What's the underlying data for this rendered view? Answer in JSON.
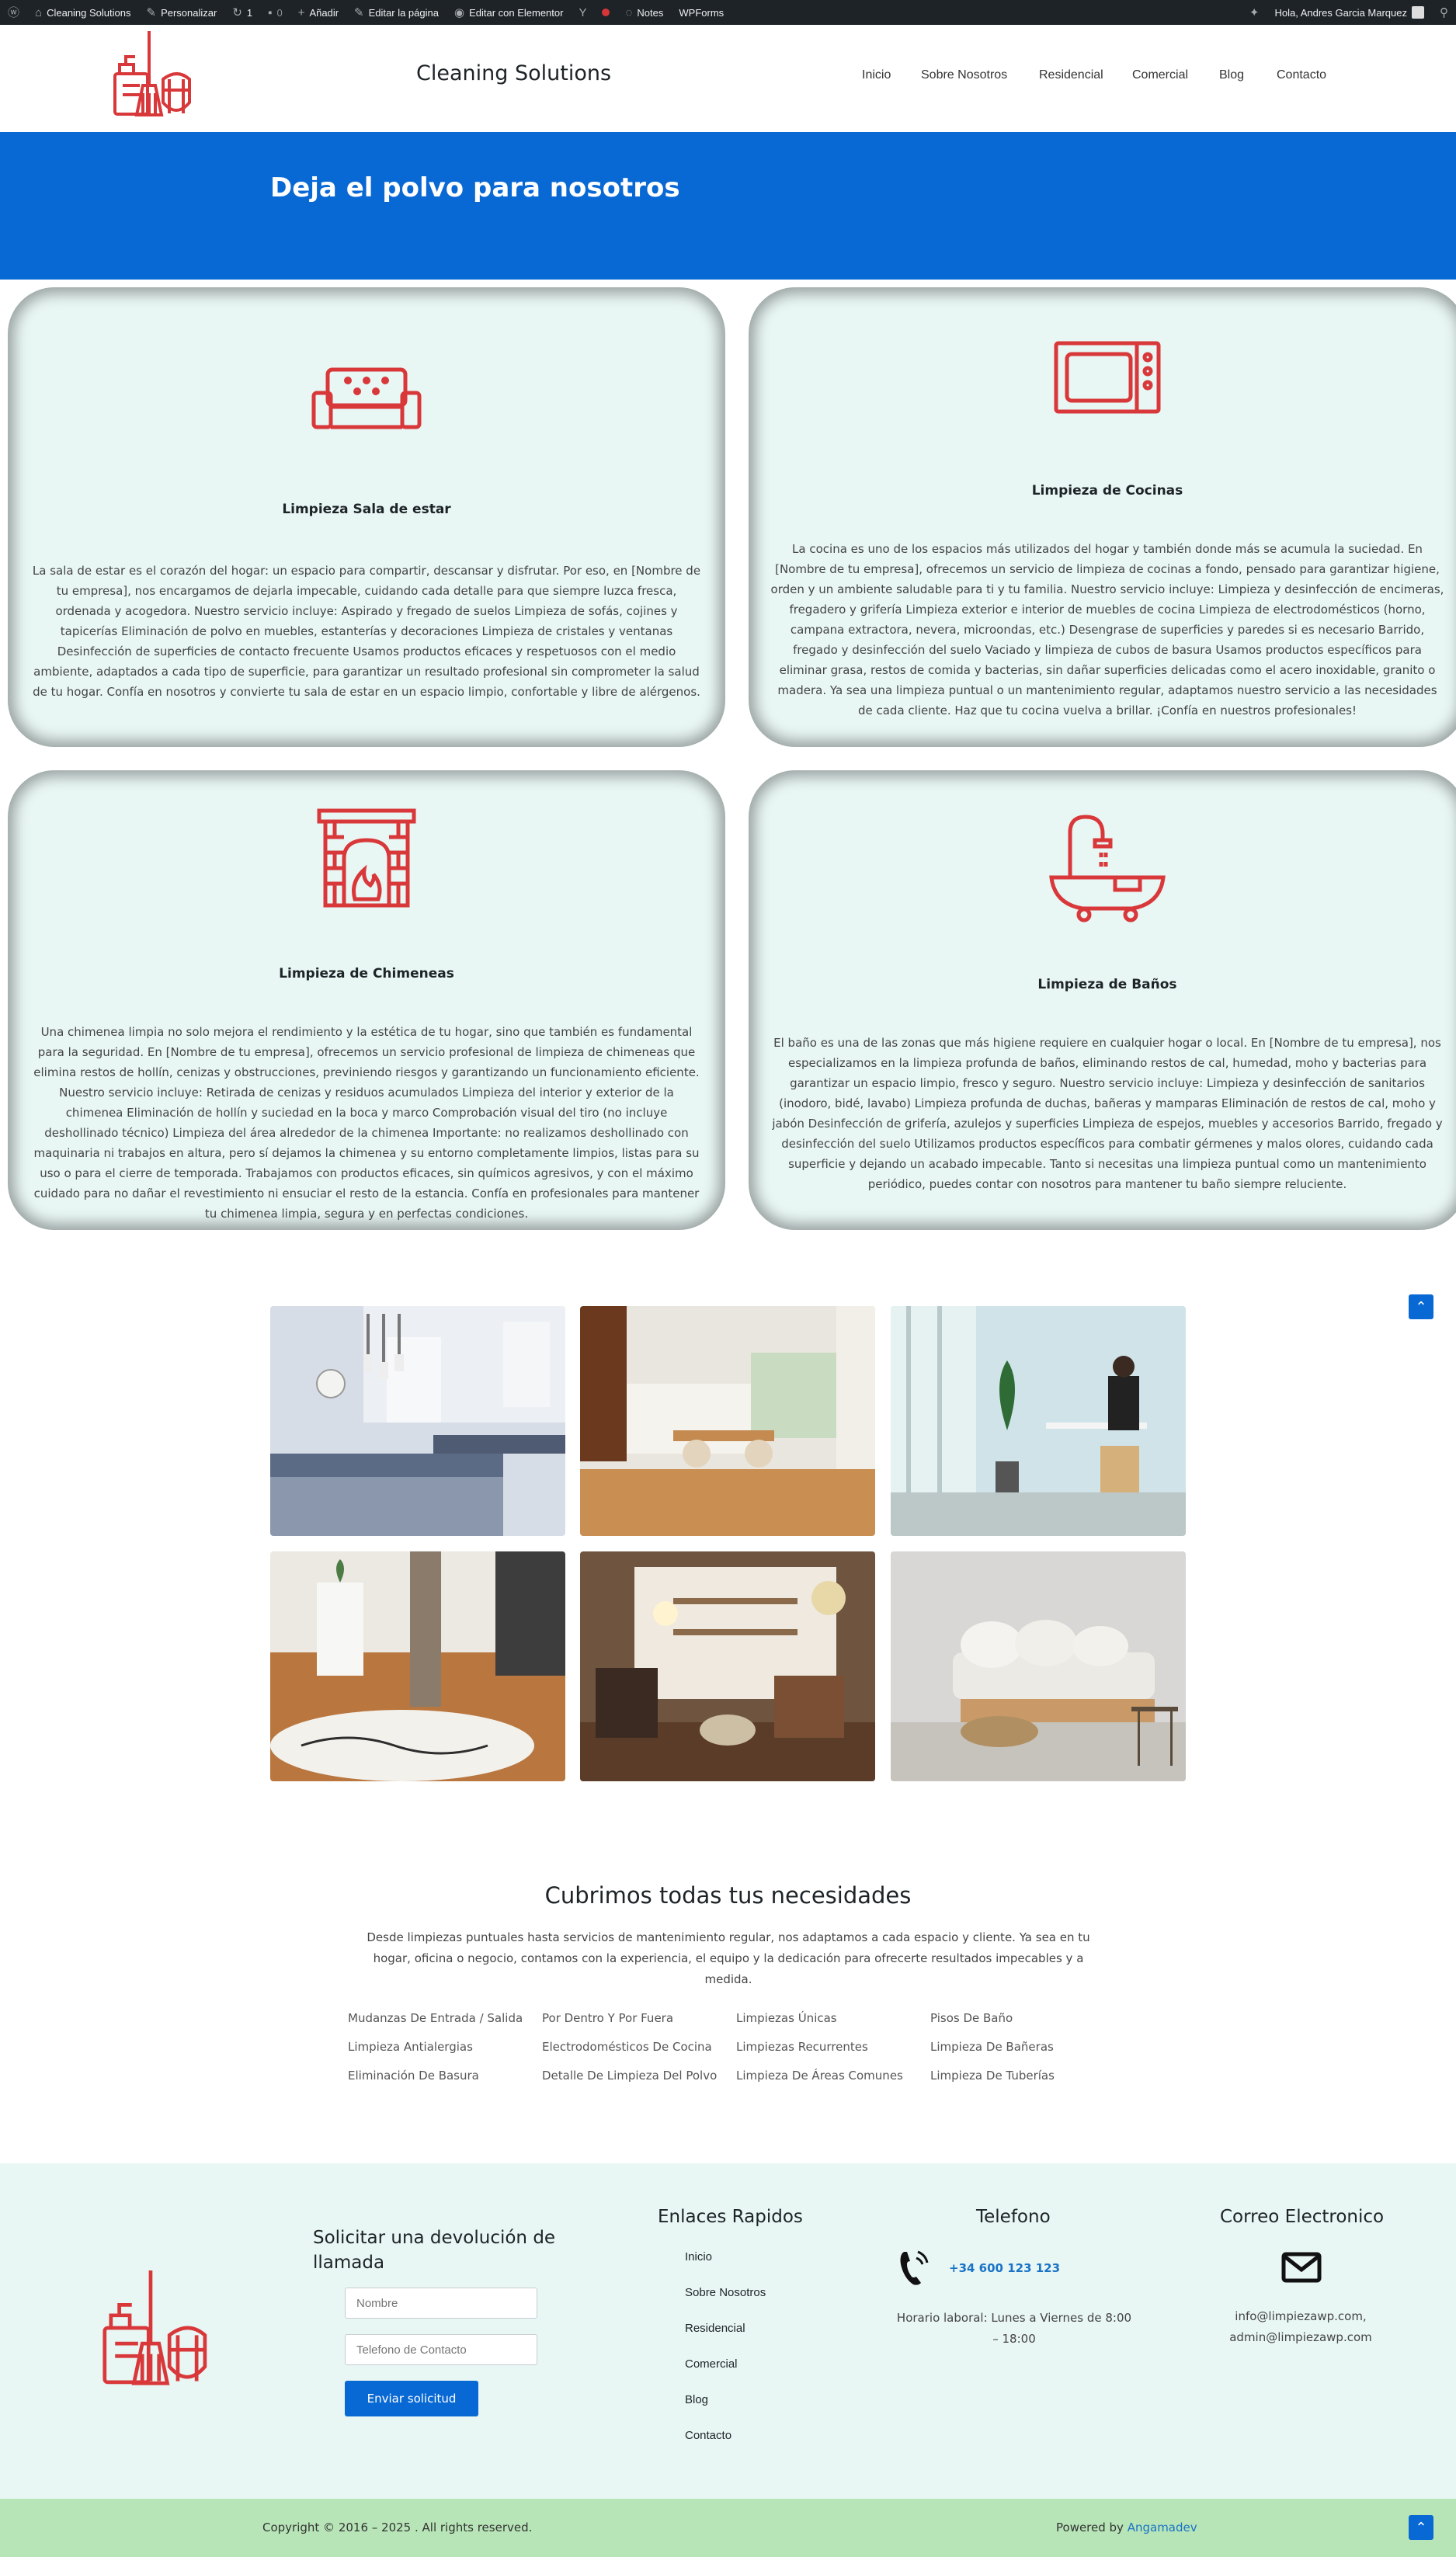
{
  "admin_bar": {
    "site_name": "Cleaning Solutions",
    "customize": "Personalizar",
    "updates": "1",
    "comments": "0",
    "add_new": "Añadir",
    "edit_page": "Editar la página",
    "edit_elementor": "Editar con Elementor",
    "notes": "Notes",
    "wpforms": "WPForms",
    "greeting": "Hola, Andres Garcia Marquez"
  },
  "header": {
    "site_title": "Cleaning Solutions",
    "nav": [
      "Inicio",
      "Sobre Nosotros",
      "Residencial",
      "Comercial",
      "Blog",
      "Contacto"
    ]
  },
  "hero": {
    "title": "Deja el polvo para nosotros"
  },
  "cards": [
    {
      "icon": "sofa-icon",
      "title": "Limpieza Sala de estar",
      "text": "La sala de estar es el corazón del hogar: un espacio para compartir, descansar y disfrutar. Por eso, en [Nombre de tu empresa], nos encargamos de dejarla impecable, cuidando cada detalle para que siempre luzca fresca, ordenada y acogedora. Nuestro servicio incluye: Aspirado y fregado de suelos Limpieza de sofás, cojines y tapicerías Eliminación de polvo en muebles, estanterías y decoraciones Limpieza de cristales y ventanas Desinfección de superficies de contacto frecuente Usamos productos eficaces y respetuosos con el medio ambiente, adaptados a cada tipo de superficie, para garantizar un resultado profesional sin comprometer la salud de tu hogar. Confía en nosotros y convierte tu sala de estar en un espacio limpio, confortable y libre de alérgenos."
    },
    {
      "icon": "microwave-icon",
      "title": "Limpieza de Cocinas",
      "text": "La cocina es uno de los espacios más utilizados del hogar y también donde más se acumula la suciedad. En [Nombre de tu empresa], ofrecemos un servicio de limpieza de cocinas a fondo, pensado para garantizar higiene, orden y un ambiente saludable para ti y tu familia. Nuestro servicio incluye: Limpieza y desinfección de encimeras, fregadero y grifería Limpieza exterior e interior de muebles de cocina Limpieza de electrodomésticos (horno, campana extractora, nevera, microondas, etc.) Desengrase de superficies y paredes si es necesario Barrido, fregado y desinfección del suelo Vaciado y limpieza de cubos de basura Usamos productos específicos para eliminar grasa, restos de comida y bacterias, sin dañar superficies delicadas como el acero inoxidable, granito o madera. Ya sea una limpieza puntual o un mantenimiento regular, adaptamos nuestro servicio a las necesidades de cada cliente. Haz que tu cocina vuelva a brillar. ¡Confía en nuestros profesionales!"
    },
    {
      "icon": "fireplace-icon",
      "title": "Limpieza de Chimeneas",
      "text": "Una chimenea limpia no solo mejora el rendimiento y la estética de tu hogar, sino que también es fundamental para la seguridad. En [Nombre de tu empresa], ofrecemos un servicio profesional de limpieza de chimeneas que elimina restos de hollín, cenizas y obstrucciones, previniendo riesgos y garantizando un funcionamiento eficiente. Nuestro servicio incluye: Retirada de cenizas y residuos acumulados Limpieza del interior y exterior de la chimenea Eliminación de hollín y suciedad en la boca y marco Comprobación visual del tiro (no incluye deshollinado técnico) Limpieza del área alrededor de la chimenea Importante: no realizamos deshollinado con maquinaria ni trabajos en altura, pero sí dejamos la chimenea y su entorno completamente limpios, listas para su uso o para el cierre de temporada. Trabajamos con productos eficaces, sin químicos agresivos, y con el máximo cuidado para no dañar el revestimiento ni ensuciar el resto de la estancia. Confía en profesionales para mantener tu chimenea limpia, segura y en perfectas condiciones."
    },
    {
      "icon": "bathtub-icon",
      "title": "Limpieza de Baños",
      "text": "El baño es una de las zonas que más higiene requiere en cualquier hogar o local. En [Nombre de tu empresa], nos especializamos en la limpieza profunda de baños, eliminando restos de cal, humedad, moho y bacterias para garantizar un espacio limpio, fresco y seguro. Nuestro servicio incluye: Limpieza y desinfección de sanitarios (inodoro, bidé, lavabo) Limpieza profunda de duchas, bañeras y mamparas Eliminación de restos de cal, moho y jabón Desinfección de grifería, azulejos y superficies Limpieza de espejos, muebles y accesorios Barrido, fregado y desinfección del suelo Utilizamos productos específicos para combatir gérmenes y malos olores, cuidando cada superficie y dejando un acabado impecable. Tanto si necesitas una limpieza puntual como un mantenimiento periódico, puedes contar con nosotros para mantener tu baño siempre reluciente."
    }
  ],
  "needs": {
    "title": "Cubrimos todas tus necesidades",
    "description": "Desde limpiezas puntuales hasta servicios de mantenimiento regular, nos adaptamos a cada espacio y cliente. Ya sea en tu hogar, oficina o negocio, contamos con la experiencia, el equipo y la dedicación para ofrecerte resultados impecables y a medida.",
    "services": [
      [
        "Mudanzas De Entrada / Salida",
        "Limpieza Antialergias",
        "Eliminación De Basura"
      ],
      [
        "Por Dentro Y Por Fuera",
        "Electrodomésticos De Cocina",
        "Detalle De Limpieza Del Polvo"
      ],
      [
        "Limpiezas Únicas",
        "Limpiezas Recurrentes",
        "Limpieza De Áreas Comunes"
      ],
      [
        "Pisos De Baño",
        "Limpieza De Bañeras",
        "Limpieza De Tuberías"
      ]
    ]
  },
  "footer": {
    "callback_title": "Solicitar una devolución de llamada",
    "name_placeholder": "Nombre",
    "phone_placeholder": "Telefono de Contacto",
    "submit_label": "Enviar solicitud",
    "links_title": "Enlaces Rapidos",
    "links": [
      "Inicio",
      "Sobre Nosotros",
      "Residencial",
      "Comercial",
      "Blog",
      "Contacto"
    ],
    "phone_title": "Telefono",
    "phone_number": "+34 600 123 123",
    "hours": "Horario laboral: Lunes a Viernes de 8:00 – 18:00",
    "email_title": "Correo Electronico",
    "emails": "info@limpiezawp.com, admin@limpiezawp.com"
  },
  "bottom_bar": {
    "copyright": "Copyright © 2016 – 2025 . All rights reserved.",
    "powered_prefix": "Powered by ",
    "powered_link": "Angamadev"
  },
  "colors": {
    "accent": "#0969d4",
    "icon_red": "#d9383a",
    "card_bg": "#e8f6f4",
    "footer_bottom": "#b7e5b7"
  }
}
